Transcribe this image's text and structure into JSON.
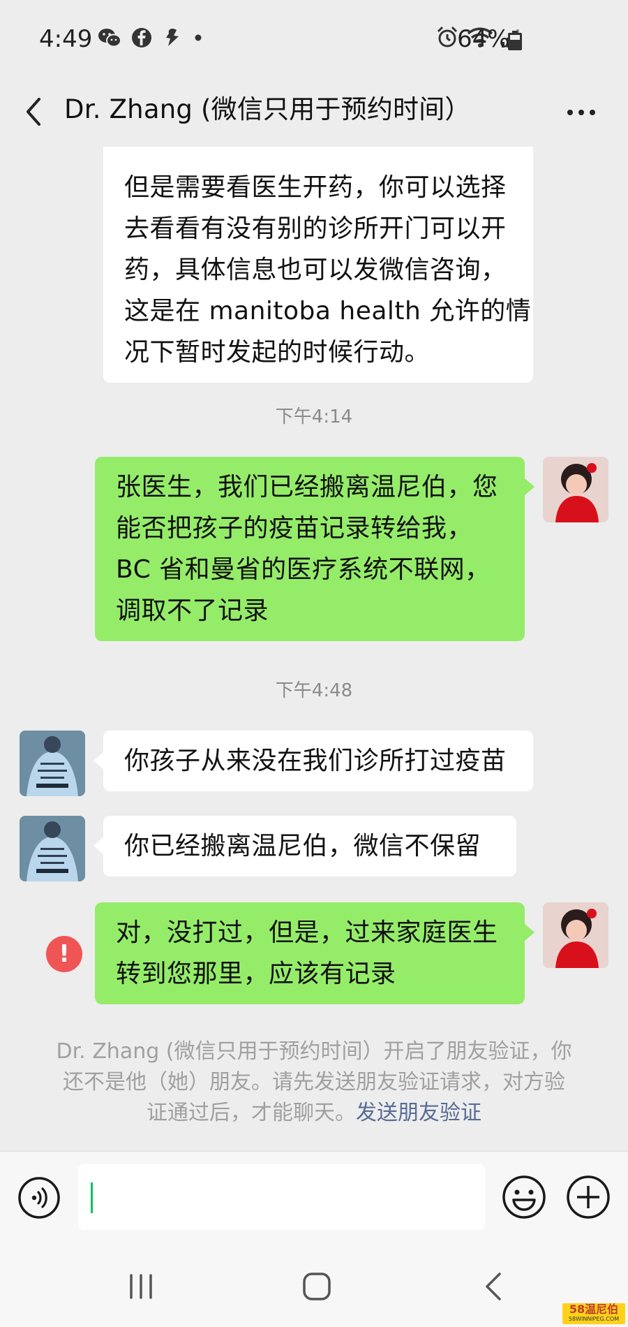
{
  "status_bar": {
    "time": "4:49",
    "battery": "64%",
    "icons_left": [
      "wechat-icon",
      "facebook-icon",
      "app-icon",
      "dot-icon"
    ],
    "icons_right": [
      "alarm-icon",
      "wifi-icon",
      "signal-icon",
      "battery-icon"
    ]
  },
  "header": {
    "title": "Dr. Zhang (微信只用于预约时间）",
    "back_icon": "chevron-left-icon",
    "more_icon": "more-icon"
  },
  "messages": [
    {
      "side": "in",
      "lines": [
        "但是需要看医生开药，你可以选择",
        "去看看有没有别的诊所开门可以开",
        "药，具体信息也可以发微信咨询，",
        "这是在 manitoba health 允许的情",
        "况下暂时发起的时候行动。"
      ]
    },
    {
      "side": "out",
      "timestamp": "下午4:14",
      "lines": [
        "张医生，我们已经搬离温尼伯，您",
        "能否把孩子的疫苗记录转给我，",
        "BC 省和曼省的医疗系统不联网，",
        "调取不了记录"
      ]
    },
    {
      "side": "in",
      "timestamp": "下午4:48",
      "lines": [
        "你孩子从来没在我们诊所打过疫苗"
      ]
    },
    {
      "side": "in",
      "lines": [
        "你已经搬离温尼伯，微信不保留"
      ]
    },
    {
      "side": "out",
      "failed": true,
      "error_mark": "!",
      "lines": [
        "对，没打过，但是，过来家庭医生",
        "转到您那里，应该有记录"
      ]
    }
  ],
  "system_notice": {
    "lines": [
      "Dr. Zhang (微信只用于预约时间）开启了朋友验证，你",
      "还不是他（她）朋友。请先发送朋友验证请求，对方验",
      "证通过后，才能聊天。"
    ],
    "link": "发送朋友验证"
  },
  "input_bar": {
    "text": "",
    "voice_icon": "voice-icon",
    "emoji_icon": "emoji-icon",
    "plus_icon": "plus-icon"
  },
  "nav_bar": {
    "icons": [
      "recents-icon",
      "home-icon",
      "back-icon"
    ]
  },
  "watermark": {
    "line1": "58温尼伯",
    "line2": "58WINNIPEG.COM"
  },
  "colors": {
    "background": "#ededed",
    "outgoing_bubble": "#95ec69",
    "incoming_bubble": "#ffffff",
    "link": "#576b95",
    "error": "#f05555",
    "caret": "#07c160"
  }
}
